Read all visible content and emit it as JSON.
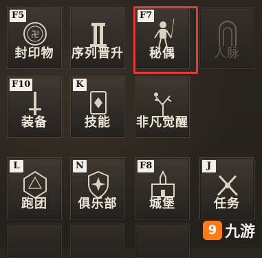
{
  "tiles": [
    {
      "label": "封印物",
      "key": "F5"
    },
    {
      "label": "序列晋升",
      "key": ""
    },
    {
      "label": "秘偶",
      "key": "F7"
    },
    {
      "label": "人脉",
      "key": ""
    },
    {
      "label": "装备",
      "key": "F10"
    },
    {
      "label": "技能",
      "key": "K"
    },
    {
      "label": "非凡觉醒",
      "key": ""
    },
    {
      "label": "跑团",
      "key": "L"
    },
    {
      "label": "俱乐部",
      "key": "N"
    },
    {
      "label": "城堡",
      "key": "F8"
    },
    {
      "label": "任务",
      "key": "J"
    }
  ],
  "watermark": {
    "logo": "9",
    "text": "九游"
  },
  "colors": {
    "highlight": "#e33a3a",
    "label": "#ece6d8"
  }
}
